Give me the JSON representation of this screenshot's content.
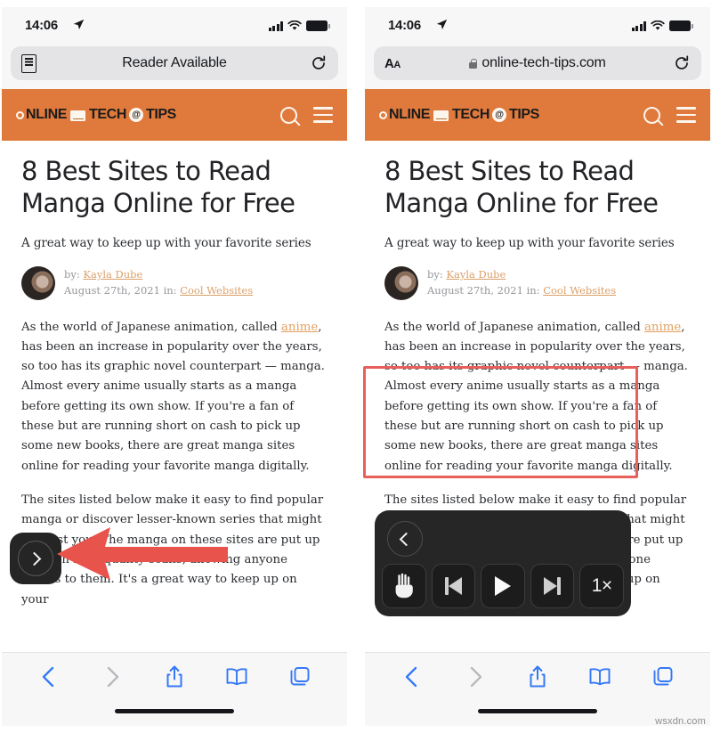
{
  "watermark": "wsxdn.com",
  "panels": [
    {
      "id": "left",
      "status": {
        "time": "14:06",
        "location_icon": "location-arrow-icon",
        "signal_icon": "cellular-bars-icon",
        "wifi_icon": "wifi-icon",
        "battery_icon": "battery-full-icon"
      },
      "addressbar": {
        "left_icon": "reader-view-icon",
        "label": "Reader Available",
        "right_icon": "reload-icon"
      },
      "site_header": {
        "logo_text_1": "NLINE",
        "logo_text_2": "TECH",
        "logo_text_3": "TIPS",
        "search_icon": "search-icon",
        "menu_icon": "hamburger-menu-icon"
      },
      "article": {
        "headline": "8 Best Sites to Read Manga Online for Free",
        "subhead": "A great way to keep up with your favorite series",
        "byline_prefix": "by:",
        "author": "Kayla Dube",
        "date": "August 27th, 2021",
        "category_prefix": "in:",
        "category": "Cool Websites",
        "paragraph1_a": "As the world of Japanese animation, called ",
        "paragraph1_link": "anime",
        "paragraph1_b": ", has been an increase in popularity over the years, so too has its graphic novel counterpart — manga. Almost every anime usually starts as a manga before getting its own show. If you're a fan of these but are running short on cash to pick up some new books, there are great manga sites online for reading your favorite manga digitally.",
        "paragraph2": "The sites listed below make it easy to find popular manga or discover lesser-known series that might interest you. The manga on these sites are put up through high-quality scans, allowing anyone access to them. It's a great way to keep up on your"
      },
      "overlay": {
        "type": "chevron-hud",
        "chevron_icon": "chevron-right-icon"
      },
      "annotation": {
        "arrow_icon": "red-left-arrow-annotation"
      },
      "toolbar": {
        "back_icon": "back-chevron-icon",
        "forward_icon": "forward-chevron-icon",
        "share_icon": "share-icon",
        "bookmarks_icon": "book-icon",
        "tabs_icon": "tabs-icon"
      }
    },
    {
      "id": "right",
      "status": {
        "time": "14:06",
        "location_icon": "location-arrow-icon",
        "signal_icon": "cellular-bars-icon",
        "wifi_icon": "wifi-icon",
        "battery_icon": "battery-full-icon"
      },
      "addressbar": {
        "left_icon": "text-size-aa-icon",
        "lock_icon": "lock-icon",
        "label": "online-tech-tips.com",
        "right_icon": "reload-icon"
      },
      "site_header": {
        "logo_text_1": "NLINE",
        "logo_text_2": "TECH",
        "logo_text_3": "TIPS",
        "search_icon": "search-icon",
        "menu_icon": "hamburger-menu-icon"
      },
      "article": {
        "headline": "8 Best Sites to Read Manga Online for Free",
        "subhead": "A great way to keep up with your favorite series",
        "byline_prefix": "by:",
        "author": "Kayla Dube",
        "date": "August 27th, 2021",
        "category_prefix": "in:",
        "category": "Cool Websites",
        "paragraph1_a": "As the world of Japanese animation, called ",
        "paragraph1_link": "anime",
        "paragraph1_b": ", has been an increase in popularity over the years, so too has its graphic novel counterpart — manga. Almost every anime usually starts as a manga before getting its own show. If you're a fan of these but are running short on cash to pick up some new books, there are great manga sites online for reading your favorite manga digitally.",
        "paragraph2": "The sites listed below make it easy to find popular manga or discover lesser-known series that might interest you. The manga on these sites are put up through high-quality scans, allowing anyone access to them. It's a great way to keep up on your"
      },
      "overlay": {
        "type": "media-controls-hud",
        "back_icon": "chevron-left-icon",
        "buttons": [
          {
            "icon": "hand-tap-icon",
            "label": ""
          },
          {
            "icon": "skip-back-icon",
            "label": ""
          },
          {
            "icon": "play-icon",
            "label": ""
          },
          {
            "icon": "skip-forward-icon",
            "label": ""
          },
          {
            "icon": "speed-icon",
            "label": "1×"
          }
        ]
      },
      "toolbar": {
        "back_icon": "back-chevron-icon",
        "forward_icon": "forward-chevron-icon",
        "share_icon": "share-icon",
        "bookmarks_icon": "book-icon",
        "tabs_icon": "tabs-icon"
      }
    }
  ],
  "colors": {
    "brand_orange": "#e07a3c",
    "link_orange": "#dba06a",
    "annotation_red": "#e8605a",
    "ios_blue": "#3478f6"
  }
}
